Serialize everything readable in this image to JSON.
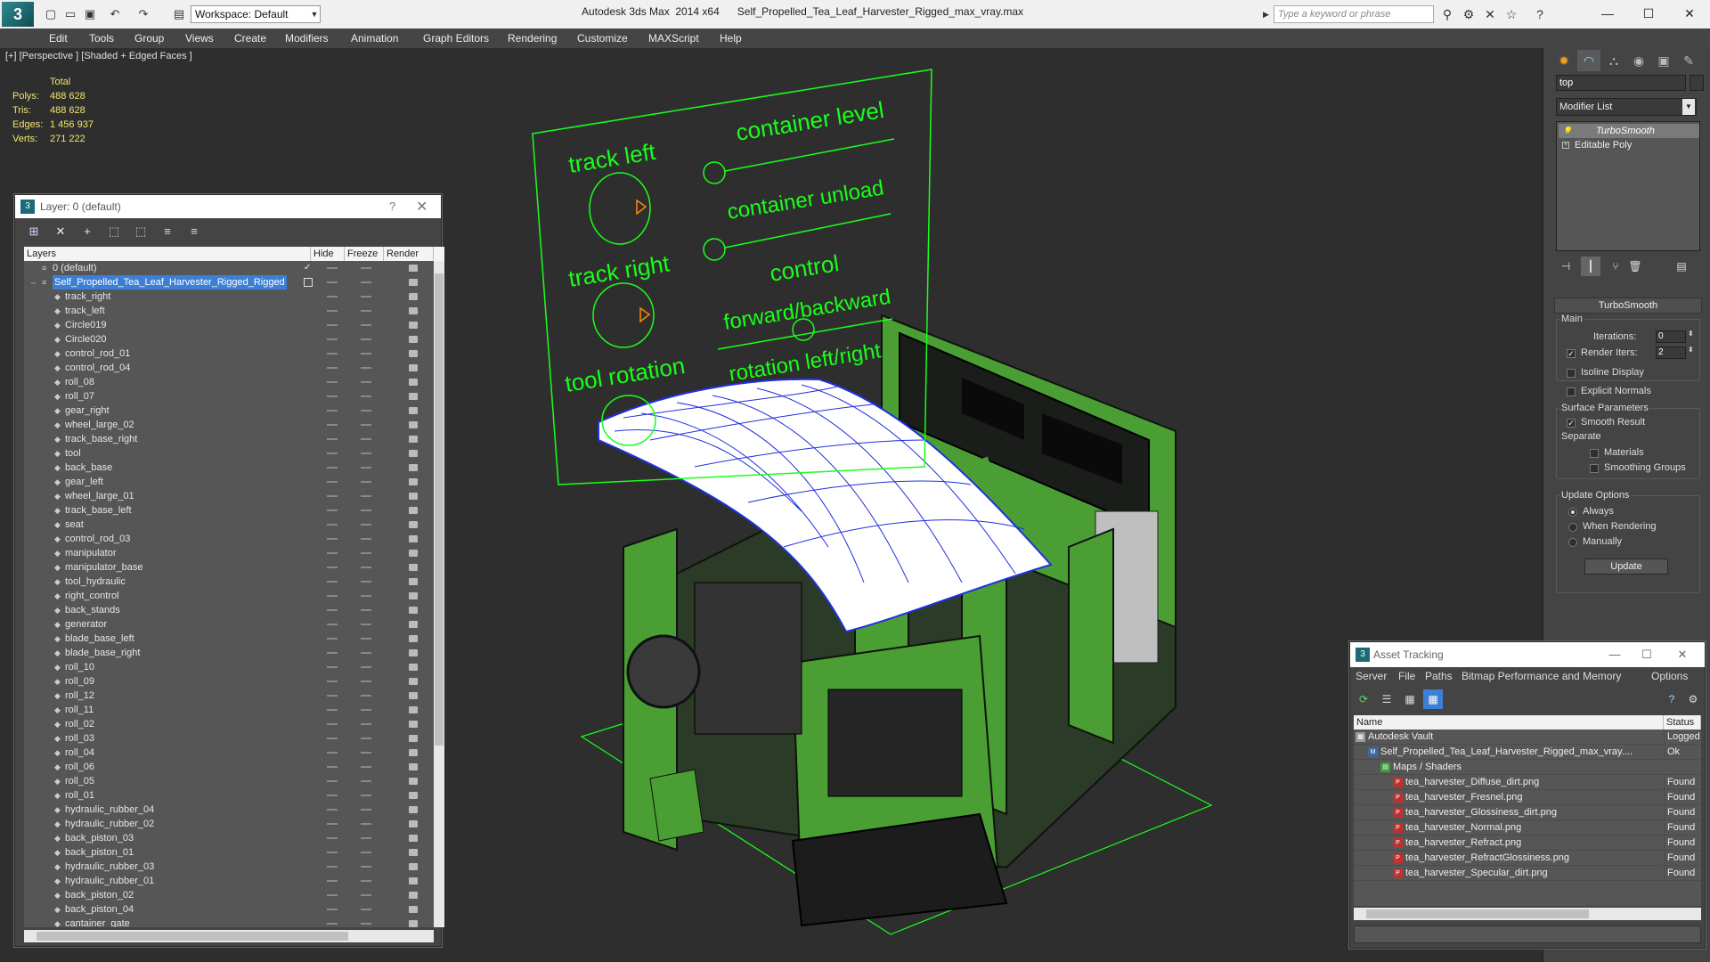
{
  "titlebar": {
    "workspace": "Workspace: Default",
    "title": "Autodesk 3ds Max  2014 x64      Self_Propelled_Tea_Leaf_Harvester_Rigged_max_vray.max",
    "search_placeholder": "Type a keyword or phrase"
  },
  "menu": [
    "Edit",
    "Tools",
    "Group",
    "Views",
    "Create",
    "Modifiers",
    "Animation",
    "Graph Editors",
    "Rendering",
    "Customize",
    "MAXScript",
    "Help"
  ],
  "viewport": {
    "label": "[+] [Perspective ] [Shaded + Edged Faces ]",
    "stats": {
      "header": "Total",
      "rows": [
        {
          "key": "Polys:",
          "value": "488 628"
        },
        {
          "key": "Tris:",
          "value": "488 628"
        },
        {
          "key": "Edges:",
          "value": "1 456 937"
        },
        {
          "key": "Verts:",
          "value": "271 222"
        }
      ]
    },
    "panel_labels": {
      "track_left": "track left",
      "track_right": "track right",
      "tool_rotation": "tool rotation",
      "container_level": "container level",
      "container_unload": "container unload",
      "control": "control",
      "forward_backward": "forward/backward",
      "rotation": "rotation left/right"
    },
    "colors": {
      "bg": "#2e2e2e",
      "wire_green": "#19ff19",
      "body_green": "#4a9e34",
      "mesh_blue": "#2030e0"
    }
  },
  "layer_panel": {
    "title": "Layer: 0 (default)",
    "columns": {
      "layers": "Layers",
      "hide": "Hide",
      "freeze": "Freeze",
      "render": "Render"
    },
    "root_layers": [
      "0 (default)",
      "Self_Propelled_Tea_Leaf_Harvester_Rigged_Rigged"
    ],
    "objects": [
      "track_right",
      "track_left",
      "Circle019",
      "Circle020",
      "control_rod_01",
      "control_rod_04",
      "roll_08",
      "roll_07",
      "gear_right",
      "wheel_large_02",
      "track_base_right",
      "tool",
      "back_base",
      "gear_left",
      "wheel_large_01",
      "track_base_left",
      "seat",
      "control_rod_03",
      "manipulator",
      "manipulator_base",
      "tool_hydraulic",
      "right_control",
      "back_stands",
      "generator",
      "blade_base_left",
      "blade_base_right",
      "roll_10",
      "roll_09",
      "roll_12",
      "roll_11",
      "roll_02",
      "roll_03",
      "roll_04",
      "roll_06",
      "roll_05",
      "roll_01",
      "hydraulic_rubber_04",
      "hydraulic_rubber_02",
      "back_piston_03",
      "back_piston_01",
      "hydraulic_rubber_03",
      "hydraulic_rubber_01",
      "back_piston_02",
      "back_piston_04",
      "cantainer_gate"
    ]
  },
  "command_panel": {
    "object_name": "top",
    "modifier_list": "Modifier List",
    "stack": [
      "TurboSmooth",
      "Editable Poly"
    ],
    "turbosmooth": {
      "title": "TurboSmooth",
      "main": "Main",
      "iterations_label": "Iterations:",
      "iterations": "0",
      "render_iters_label": "Render Iters:",
      "render_iters": "2",
      "isoline": "Isoline Display",
      "explicit_normals": "Explicit Normals",
      "surface_params": "Surface Parameters",
      "smooth_result": "Smooth Result",
      "separate": "Separate",
      "materials": "Materials",
      "smoothing_groups": "Smoothing Groups",
      "update_options": "Update Options",
      "always": "Always",
      "when_rendering": "When Rendering",
      "manually": "Manually",
      "update": "Update"
    }
  },
  "asset_panel": {
    "title": "Asset Tracking",
    "menu": [
      "Server",
      "File",
      "Paths",
      "Bitmap Performance and Memory",
      "Options"
    ],
    "columns": {
      "name": "Name",
      "status": "Status"
    },
    "rows": [
      {
        "name": "Autodesk Vault",
        "status": "Logged O",
        "level": 0,
        "icon": "vault"
      },
      {
        "name": "Self_Propelled_Tea_Leaf_Harvester_Rigged_max_vray....",
        "status": "Ok",
        "level": 1,
        "icon": "max"
      },
      {
        "name": "Maps / Shaders",
        "status": "",
        "level": 2,
        "icon": "maps"
      },
      {
        "name": "tea_harvester_Diffuse_dirt.png",
        "status": "Found",
        "level": 3,
        "icon": "png"
      },
      {
        "name": "tea_harvester_Fresnel.png",
        "status": "Found",
        "level": 3,
        "icon": "png"
      },
      {
        "name": "tea_harvester_Glossiness_dirt.png",
        "status": "Found",
        "level": 3,
        "icon": "png"
      },
      {
        "name": "tea_harvester_Normal.png",
        "status": "Found",
        "level": 3,
        "icon": "png"
      },
      {
        "name": "tea_harvester_Refract.png",
        "status": "Found",
        "level": 3,
        "icon": "png"
      },
      {
        "name": "tea_harvester_RefractGlossiness.png",
        "status": "Found",
        "level": 3,
        "icon": "png"
      },
      {
        "name": "tea_harvester_Specular_dirt.png",
        "status": "Found",
        "level": 3,
        "icon": "png"
      }
    ]
  }
}
